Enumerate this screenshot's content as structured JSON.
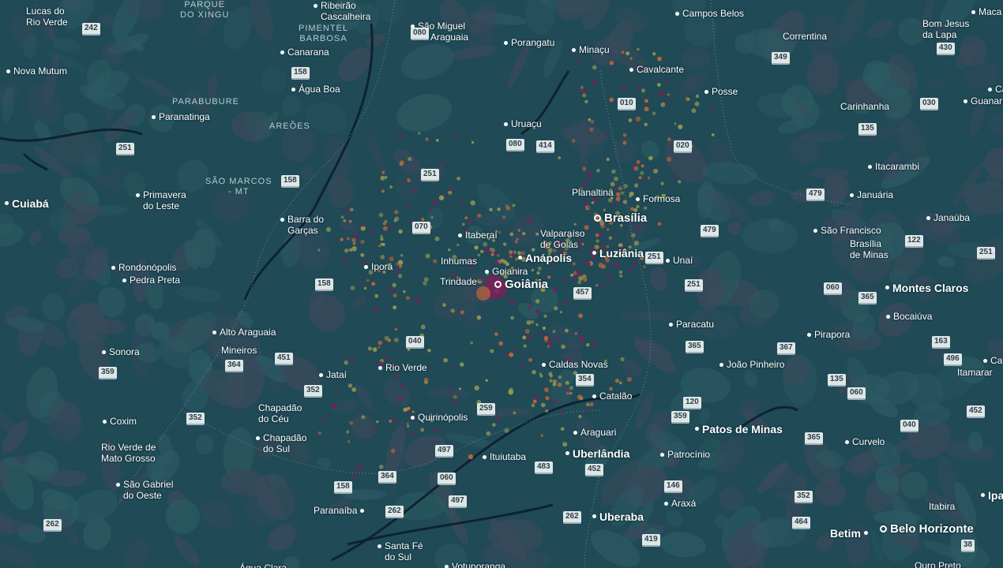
{
  "map": {
    "colors": {
      "background": "#1f4a56",
      "terrain_dark": "#3a4a5c",
      "terrain_mid": "#2c5a63",
      "water": "#0b1f2e",
      "boundary": "#6f8f97",
      "heat_low": "#9a9a50",
      "heat_mid": "#c2663a",
      "heat_high": "#7a1f5a",
      "label": "#ffffff"
    },
    "regions": [
      {
        "text": "PARQUE\nDO XINGU"
      },
      {
        "text": "PIMENTEL\nBARBOSA"
      },
      {
        "text": "PARABUBURE"
      },
      {
        "text": "AREÕES"
      },
      {
        "text": "SÃO MARCOS\n- MT"
      }
    ],
    "cities": [
      {
        "name": "Lucas do\nRio Verde",
        "rank": 1
      },
      {
        "name": "Ribeirão\nCascalheira",
        "rank": 1
      },
      {
        "name": "São Miguel\ndo Araguaia",
        "rank": 1
      },
      {
        "name": "Porangatu",
        "rank": 1
      },
      {
        "name": "Minaçu",
        "rank": 1
      },
      {
        "name": "Campos Belos",
        "rank": 1
      },
      {
        "name": "Correntina",
        "rank": 1
      },
      {
        "name": "Bom Jesus\nda Lapa",
        "rank": 1
      },
      {
        "name": "Maca",
        "rank": 1
      },
      {
        "name": "Nova Mutum",
        "rank": 1
      },
      {
        "name": "Canarana",
        "rank": 1
      },
      {
        "name": "Água Boa",
        "rank": 1
      },
      {
        "name": "Cavalcante",
        "rank": 1
      },
      {
        "name": "Posse",
        "rank": 1
      },
      {
        "name": "Carinhanha",
        "rank": 1
      },
      {
        "name": "Guanar",
        "rank": 1
      },
      {
        "name": "Ca",
        "rank": 1
      },
      {
        "name": "Paranatinga",
        "rank": 1
      },
      {
        "name": "Uruaçu",
        "rank": 1
      },
      {
        "name": "Itacarambi",
        "rank": 1
      },
      {
        "name": "Cuiabá",
        "rank": 2
      },
      {
        "name": "Primavera\ndo Leste",
        "rank": 1
      },
      {
        "name": "Planaltina",
        "rank": 1
      },
      {
        "name": "Formosa",
        "rank": 1
      },
      {
        "name": "Januária",
        "rank": 1
      },
      {
        "name": "Barra do\nGarças",
        "rank": 1
      },
      {
        "name": "Brasília",
        "rank": 3
      },
      {
        "name": "Janaúba",
        "rank": 1
      },
      {
        "name": "Itaberaí",
        "rank": 1
      },
      {
        "name": "Valparaíso\nde Goiás",
        "rank": 1
      },
      {
        "name": "São Francisco",
        "rank": 1
      },
      {
        "name": "Brasília\nde Minas",
        "rank": 1
      },
      {
        "name": "Luziânia",
        "rank": 2
      },
      {
        "name": "Anápolis",
        "rank": 2
      },
      {
        "name": "Inhumas",
        "rank": 1
      },
      {
        "name": "Rondonópolis",
        "rank": 1
      },
      {
        "name": "Iporá",
        "rank": 1
      },
      {
        "name": "Unaí",
        "rank": 1
      },
      {
        "name": "Goianira",
        "rank": 1
      },
      {
        "name": "Pedra Preta",
        "rank": 1
      },
      {
        "name": "Trindade",
        "rank": 1
      },
      {
        "name": "Goiânia",
        "rank": 3
      },
      {
        "name": "Montes Claros",
        "rank": 2
      },
      {
        "name": "Bocaiúva",
        "rank": 1
      },
      {
        "name": "Paracatu",
        "rank": 1
      },
      {
        "name": "Alto Araguaia",
        "rank": 1
      },
      {
        "name": "Pirapora",
        "rank": 1
      },
      {
        "name": "Sonora",
        "rank": 1
      },
      {
        "name": "Mineiros",
        "rank": 1
      },
      {
        "name": "João Pinheiro",
        "rank": 1
      },
      {
        "name": "Caldas Novas",
        "rank": 1
      },
      {
        "name": "Rio Verde",
        "rank": 1
      },
      {
        "name": "Jataí",
        "rank": 1
      },
      {
        "name": "Ca",
        "rank": 1
      },
      {
        "name": "Itamarar",
        "rank": 1
      },
      {
        "name": "Catalão",
        "rank": 1
      },
      {
        "name": "Chapadão\ndo Céu",
        "rank": 1
      },
      {
        "name": "Coxim",
        "rank": 1
      },
      {
        "name": "Quirinópolis",
        "rank": 1
      },
      {
        "name": "Patos de Minas",
        "rank": 2
      },
      {
        "name": "Araguari",
        "rank": 1
      },
      {
        "name": "Chapadão\ndo Sul",
        "rank": 1
      },
      {
        "name": "Curvelo",
        "rank": 1
      },
      {
        "name": "Rio Verde de\nMato Grosso",
        "rank": 1
      },
      {
        "name": "Uberlândia",
        "rank": 2
      },
      {
        "name": "Patrocínio",
        "rank": 1
      },
      {
        "name": "Ituiutaba",
        "rank": 1
      },
      {
        "name": "São Gabriel\ndo Oeste",
        "rank": 1
      },
      {
        "name": "Araxá",
        "rank": 1
      },
      {
        "name": "Itabira",
        "rank": 1
      },
      {
        "name": "Ipa",
        "rank": 2
      },
      {
        "name": "Paranaíba",
        "rank": 1
      },
      {
        "name": "Uberaba",
        "rank": 2
      },
      {
        "name": "Belo Horizonte",
        "rank": 3
      },
      {
        "name": "Betim",
        "rank": 2
      },
      {
        "name": "Santa Fé\ndo Sul",
        "rank": 1
      },
      {
        "name": "Votuporanga",
        "rank": 1
      },
      {
        "name": "Ouro Preto",
        "rank": 1
      },
      {
        "name": "Água Clara",
        "rank": 1
      }
    ],
    "road_shields": [
      "242",
      "080",
      "158",
      "251",
      "158",
      "010",
      "414",
      "080",
      "020",
      "349",
      "430",
      "030",
      "135",
      "251",
      "479",
      "070",
      "479",
      "122",
      "251",
      "251",
      "158",
      "457",
      "365",
      "251",
      "060",
      "040",
      "365",
      "367",
      "163",
      "359",
      "364",
      "451",
      "496",
      "135",
      "060",
      "352",
      "354",
      "120",
      "359",
      "452",
      "352",
      "259",
      "040",
      "365",
      "497",
      "452",
      "483",
      "364",
      "060",
      "146",
      "352",
      "158",
      "497",
      "262",
      "262",
      "464",
      "419",
      "262",
      "38"
    ]
  }
}
